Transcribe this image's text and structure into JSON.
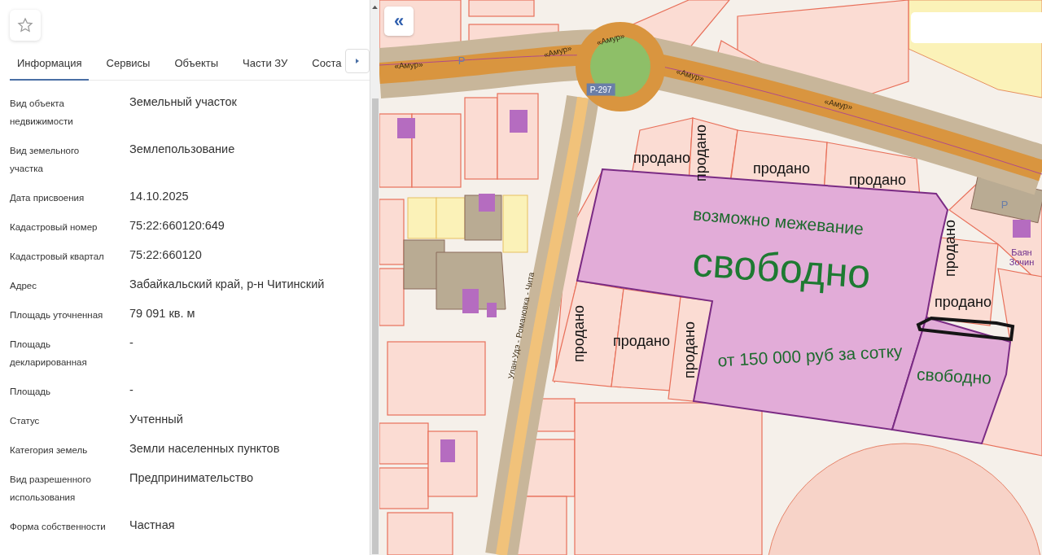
{
  "favorite_button": {
    "selected": false
  },
  "tabs": [
    {
      "label": "Информация",
      "selected": true
    },
    {
      "label": "Сервисы",
      "selected": false
    },
    {
      "label": "Объекты",
      "selected": false
    },
    {
      "label": "Части ЗУ",
      "selected": false
    },
    {
      "label": "Соста",
      "selected": false
    }
  ],
  "properties": [
    {
      "label": "Вид объекта недвижимости",
      "value": "Земельный участок"
    },
    {
      "label": "Вид земельного участка",
      "value": "Землепользование"
    },
    {
      "label": "Дата присвоения",
      "value": "14.10.2025"
    },
    {
      "label": "Кадастровый номер",
      "value": "75:22:660120:649"
    },
    {
      "label": "Кадастровый квартал",
      "value": "75:22:660120"
    },
    {
      "label": "Адрес",
      "value": "Забайкальский край, р-н Читинский"
    },
    {
      "label": "Площадь уточненная",
      "value": "79 091 кв. м"
    },
    {
      "label": "Площадь декларированная",
      "value": "-"
    },
    {
      "label": "Площадь",
      "value": "-"
    },
    {
      "label": "Статус",
      "value": "Учтенный"
    },
    {
      "label": "Категория земель",
      "value": "Земли населенных пунктов"
    },
    {
      "label": "Вид разрешенного использования",
      "value": "Предпринимательство"
    },
    {
      "label": "Форма собственности",
      "value": "Частная"
    }
  ],
  "map": {
    "collapse_button": "«",
    "labels": [
      {
        "text": "продано",
        "kind": "annotation"
      },
      {
        "text": "продано",
        "kind": "annotation"
      },
      {
        "text": "продано",
        "kind": "annotation"
      },
      {
        "text": "продано",
        "kind": "annotation"
      },
      {
        "text": "возможно межевание",
        "kind": "annotation-green"
      },
      {
        "text": "свободно",
        "kind": "annotation-large"
      },
      {
        "text": "продано",
        "kind": "annotation"
      },
      {
        "text": "продано",
        "kind": "annotation"
      },
      {
        "text": "продано",
        "kind": "annotation"
      },
      {
        "text": "продано",
        "kind": "annotation"
      },
      {
        "text": "продано",
        "kind": "annotation"
      },
      {
        "text": "от 150 000 руб за сотку",
        "kind": "annotation-green"
      },
      {
        "text": "свободно",
        "kind": "annotation-green"
      },
      {
        "text": "«Амур»",
        "kind": "road"
      },
      {
        "text": "«Амур»",
        "kind": "road"
      },
      {
        "text": "«Амур»",
        "kind": "road"
      },
      {
        "text": "«Амур»",
        "kind": "road"
      },
      {
        "text": "«Амур»",
        "kind": "road"
      },
      {
        "text": "Р-297",
        "kind": "route-badge"
      },
      {
        "text": "Улан-Удэ - Романовка - Чита",
        "kind": "road"
      },
      {
        "text": "Баян Зочин",
        "kind": "place"
      },
      {
        "text": "Р",
        "kind": "parking"
      },
      {
        "text": "Р",
        "kind": "parking"
      }
    ]
  }
}
